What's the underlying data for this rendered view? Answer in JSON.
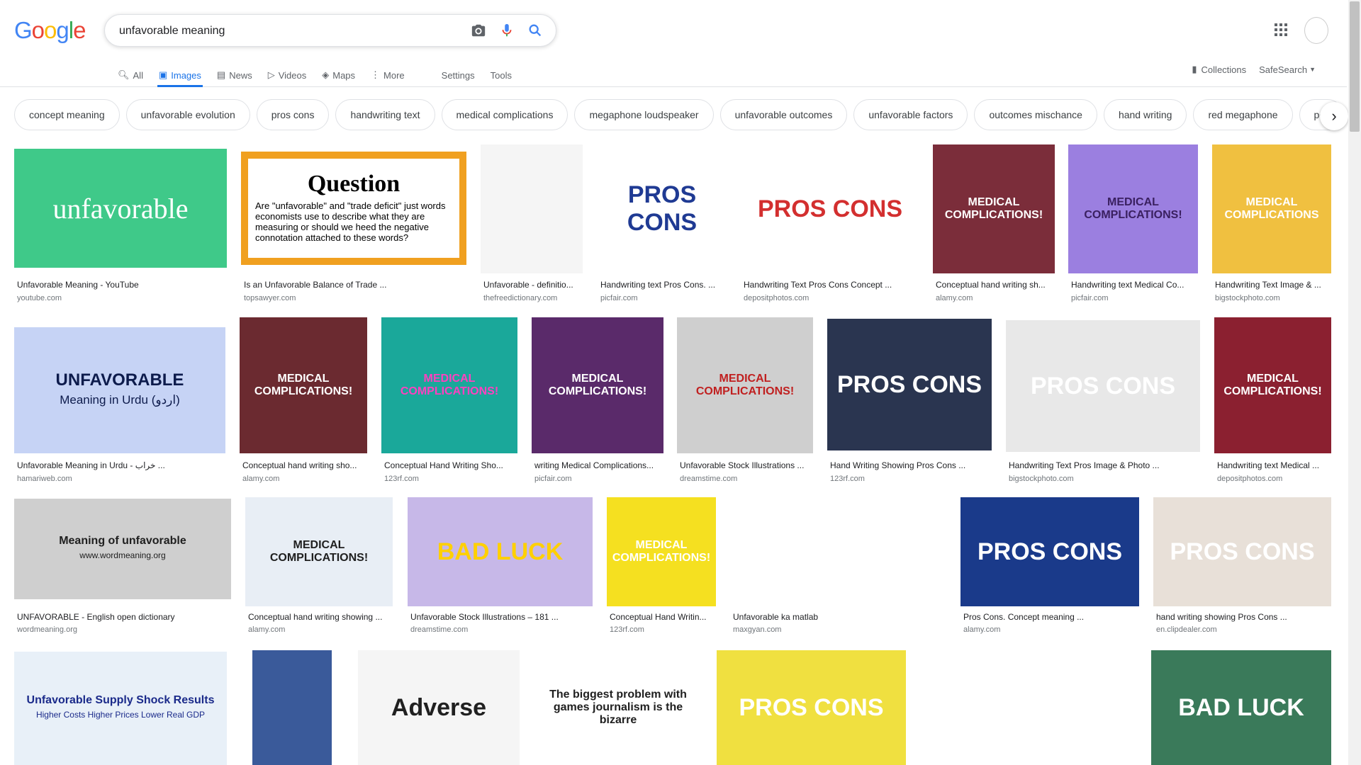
{
  "search": {
    "query": "unfavorable meaning",
    "logo_letters": [
      {
        "ch": "G",
        "color": "#4285f4"
      },
      {
        "ch": "o",
        "color": "#ea4335"
      },
      {
        "ch": "o",
        "color": "#fbbc05"
      },
      {
        "ch": "g",
        "color": "#4285f4"
      },
      {
        "ch": "l",
        "color": "#34a853"
      },
      {
        "ch": "e",
        "color": "#ea4335"
      }
    ]
  },
  "tabs": {
    "all": "All",
    "images": "Images",
    "news": "News",
    "videos": "Videos",
    "maps": "Maps",
    "more": "More",
    "settings": "Settings",
    "tools": "Tools",
    "collections": "Collections",
    "safesearch": "SafeSearch"
  },
  "chips": [
    "concept meaning",
    "unfavorable evolution",
    "pros cons",
    "handwriting text",
    "medical complications",
    "megaphone loudspeaker",
    "unfavorable outcomes",
    "unfavorable factors",
    "outcomes mischance",
    "hand writing",
    "red megaphone",
    "per"
  ],
  "results": [
    {
      "title": "Unfavorable Meaning - YouTube",
      "source": "youtube.com",
      "bg": "#3fc989",
      "text": "unfavorable",
      "color": "#ffffff"
    },
    {
      "title": "Is an Unfavorable Balance of Trade ...",
      "source": "topsawyer.com",
      "bg": "#f0a020",
      "text": "Question",
      "color": "#000000",
      "sub": "Are \"unfavorable\" and \"trade deficit\" just words economists use to describe what they are measuring or should we heed the negative connotation attached to these words?"
    },
    {
      "title": "Unfavorable - definitio...",
      "source": "thefreedictionary.com",
      "bg": "#f5f5f5",
      "text": "",
      "color": "#000"
    },
    {
      "title": "Handwriting text Pros Cons. ...",
      "source": "picfair.com",
      "bg": "#ffffff",
      "text": "PROS CONS",
      "color": "#1f3a93"
    },
    {
      "title": "Handwriting Text Pros Cons Concept ...",
      "source": "depositphotos.com",
      "bg": "#ffffff",
      "text": "PROS CONS",
      "color": "#d32f2f"
    },
    {
      "title": "Conceptual hand writing sh...",
      "source": "alamy.com",
      "bg": "#7b2d3a",
      "text": "MEDICAL COMPLICATIONS!",
      "color": "#ffffff"
    },
    {
      "title": "Handwriting text Medical Co...",
      "source": "picfair.com",
      "bg": "#9b7fe0",
      "text": "MEDICAL COMPLICATIONS!",
      "color": "#3a2060"
    },
    {
      "title": "Handwriting Text Image & ...",
      "source": "bigstockphoto.com",
      "bg": "#f0c040",
      "text": "MEDICAL COMPLICATIONS",
      "color": "#ffffff"
    },
    {
      "title": "Unfavorable Meaning in Urdu - خراب ...",
      "source": "hamariweb.com",
      "bg": "#c6d3f5",
      "text": "UNFAVORABLE",
      "color": "#0d1b4c",
      "sub": "Meaning in Urdu (اردو)"
    },
    {
      "title": "Conceptual hand writing sho...",
      "source": "alamy.com",
      "bg": "#6b2a30",
      "text": "MEDICAL COMPLICATIONS!",
      "color": "#ffffff"
    },
    {
      "title": "Conceptual Hand Writing Sho...",
      "source": "123rf.com",
      "bg": "#1aa89a",
      "text": "MEDICAL COMPLICATIONS!",
      "color": "#ff40c0"
    },
    {
      "title": "writing Medical Complications...",
      "source": "picfair.com",
      "bg": "#5a2a6a",
      "text": "MEDICAL COMPLICATIONS!",
      "color": "#ffffff"
    },
    {
      "title": "Unfavorable Stock Illustrations ...",
      "source": "dreamstime.com",
      "bg": "#cfcfcf",
      "text": "MEDICAL COMPLICATIONS!",
      "color": "#c02020"
    },
    {
      "title": "Hand Writing Showing Pros Cons ...",
      "source": "123rf.com",
      "bg": "#2a3550",
      "text": "PROS CONS",
      "color": "#ffffff"
    },
    {
      "title": "Handwriting Text Pros Image & Photo ...",
      "source": "bigstockphoto.com",
      "bg": "#e8e8e8",
      "text": "PROS CONS",
      "color": "#ffffff"
    },
    {
      "title": "Handwriting text Medical ...",
      "source": "depositphotos.com",
      "bg": "#8b2030",
      "text": "MEDICAL COMPLICATIONS!",
      "color": "#ffffff"
    },
    {
      "title": "UNFAVORABLE - English open dictionary",
      "source": "wordmeaning.org",
      "bg": "#cfcfcf",
      "text": "Meaning of unfavorable",
      "color": "#202020",
      "sub": "www.wordmeaning.org"
    },
    {
      "title": "Conceptual hand writing showing ...",
      "source": "alamy.com",
      "bg": "#e8eef5",
      "text": "MEDICAL COMPLICATIONS!",
      "color": "#202020"
    },
    {
      "title": "Unfavorable Stock Illustrations – 181 ...",
      "source": "dreamstime.com",
      "bg": "#c7b8e8",
      "text": "BAD LUCK",
      "color": "#ffd000"
    },
    {
      "title": "Conceptual Hand Writin...",
      "source": "123rf.com",
      "bg": "#f5e020",
      "text": "MEDICAL COMPLICATIONS!",
      "color": "#ffffff"
    },
    {
      "title": "Unfavorable ka matlab",
      "source": "maxgyan.com",
      "bg": "#ffffff",
      "text": "",
      "color": "#1a73e8"
    },
    {
      "title": "Pros Cons. Concept meaning ...",
      "source": "alamy.com",
      "bg": "#1a3a8a",
      "text": "PROS CONS",
      "color": "#ffffff"
    },
    {
      "title": "hand writing showing Pros Cons ...",
      "source": "en.clipdealer.com",
      "bg": "#e8e0d8",
      "text": "PROS CONS",
      "color": "#ffffff"
    },
    {
      "title": "",
      "source": "",
      "bg": "#e8f0f8",
      "text": "Unfavorable Supply Shock Results",
      "color": "#1a2a8a",
      "sub": "Higher Costs Higher Prices Lower Real GDP"
    },
    {
      "title": "",
      "source": "",
      "bg": "#3a5a9a",
      "text": "",
      "color": "#ffffff"
    },
    {
      "title": "",
      "source": "",
      "bg": "#f5f5f5",
      "text": "Adverse",
      "color": "#202020"
    },
    {
      "title": "",
      "source": "",
      "bg": "#ffffff",
      "text": "The biggest problem with games journalism is the bizarre",
      "color": "#202020"
    },
    {
      "title": "",
      "source": "",
      "bg": "#f0e040",
      "text": "PROS CONS",
      "color": "#ffffff"
    },
    {
      "title": "",
      "source": "",
      "bg": "#ffffff",
      "text": "",
      "color": "#c02020"
    },
    {
      "title": "",
      "source": "",
      "bg": "#3a7a5a",
      "text": "BAD LUCK",
      "color": "#ffffff"
    }
  ]
}
